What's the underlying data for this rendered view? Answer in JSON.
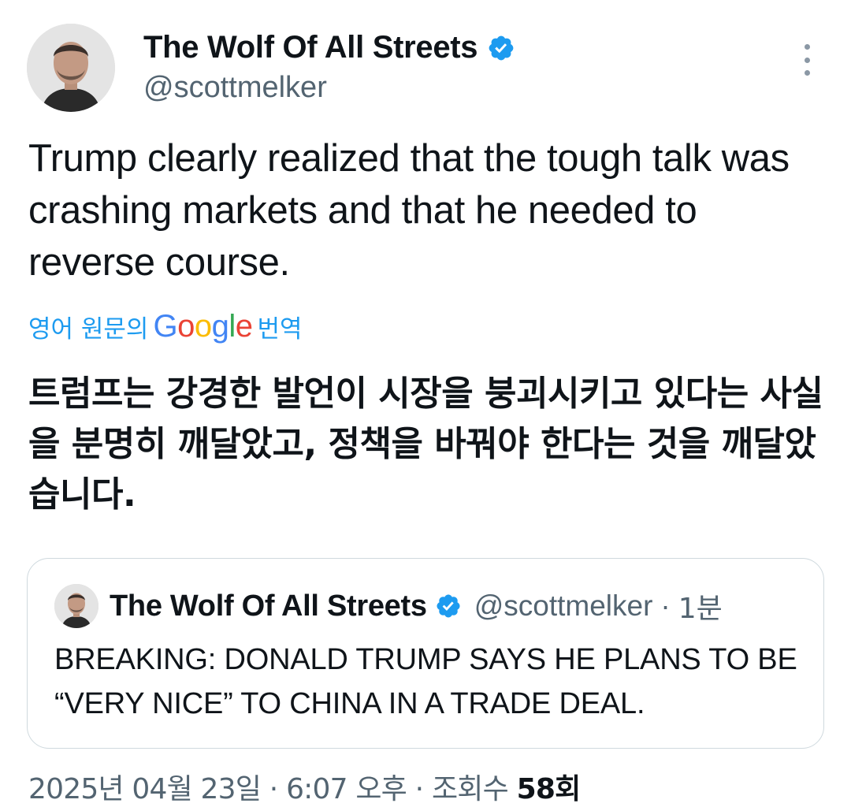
{
  "author": {
    "display_name": "The Wolf Of All Streets",
    "handle": "@scottmelker"
  },
  "tweet": {
    "text": "Trump clearly realized that the tough talk was crashing markets and that he needed to reverse course."
  },
  "translation": {
    "prefix": "영어 원문의",
    "brand": "Google",
    "suffix": "번역",
    "text": "트럼프는 강경한 발언이 시장을 붕괴시키고 있다는 사실을 분명히 깨달았고, 정책을 바꿔야 한다는 것을 깨달았습니다."
  },
  "quoted_tweet": {
    "display_name": "The Wolf Of All Streets",
    "handle": "@scottmelker",
    "separator": "·",
    "time": "1분",
    "text": "BREAKING: DONALD TRUMP SAYS HE PLANS TO BE “VERY NICE” TO CHINA IN A TRADE DEAL."
  },
  "meta": {
    "date": "2025년 04월 23일",
    "separator": "·",
    "time": "6:07 오후",
    "views_label": "조회수",
    "views_count": "58회"
  },
  "icons": {
    "verified": "verified-badge-icon",
    "more": "more-options-icon"
  },
  "colors": {
    "accent": "#1d9bf0",
    "text_primary": "#0f1419",
    "text_secondary": "#536471",
    "border": "#cfd9de",
    "google_blue": "#4285f4",
    "google_red": "#ea4335",
    "google_yellow": "#fbbc05",
    "google_green": "#34a853"
  }
}
